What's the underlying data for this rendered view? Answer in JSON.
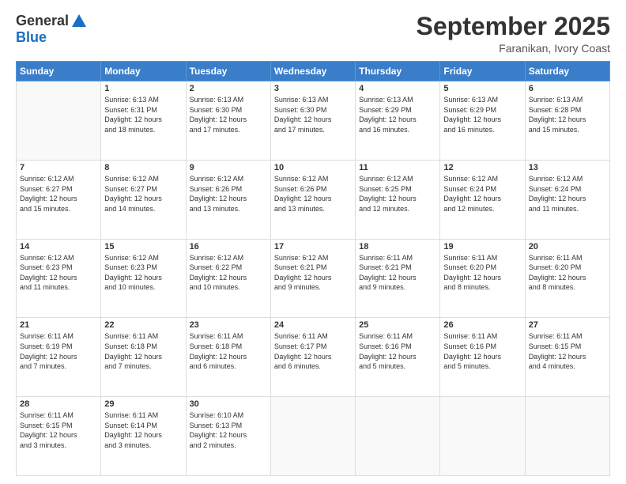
{
  "logo": {
    "general": "General",
    "blue": "Blue"
  },
  "header": {
    "month": "September 2025",
    "location": "Faranikan, Ivory Coast"
  },
  "weekdays": [
    "Sunday",
    "Monday",
    "Tuesday",
    "Wednesday",
    "Thursday",
    "Friday",
    "Saturday"
  ],
  "weeks": [
    [
      {
        "day": "",
        "info": ""
      },
      {
        "day": "1",
        "info": "Sunrise: 6:13 AM\nSunset: 6:31 PM\nDaylight: 12 hours\nand 18 minutes."
      },
      {
        "day": "2",
        "info": "Sunrise: 6:13 AM\nSunset: 6:30 PM\nDaylight: 12 hours\nand 17 minutes."
      },
      {
        "day": "3",
        "info": "Sunrise: 6:13 AM\nSunset: 6:30 PM\nDaylight: 12 hours\nand 17 minutes."
      },
      {
        "day": "4",
        "info": "Sunrise: 6:13 AM\nSunset: 6:29 PM\nDaylight: 12 hours\nand 16 minutes."
      },
      {
        "day": "5",
        "info": "Sunrise: 6:13 AM\nSunset: 6:29 PM\nDaylight: 12 hours\nand 16 minutes."
      },
      {
        "day": "6",
        "info": "Sunrise: 6:13 AM\nSunset: 6:28 PM\nDaylight: 12 hours\nand 15 minutes."
      }
    ],
    [
      {
        "day": "7",
        "info": "Sunrise: 6:12 AM\nSunset: 6:27 PM\nDaylight: 12 hours\nand 15 minutes."
      },
      {
        "day": "8",
        "info": "Sunrise: 6:12 AM\nSunset: 6:27 PM\nDaylight: 12 hours\nand 14 minutes."
      },
      {
        "day": "9",
        "info": "Sunrise: 6:12 AM\nSunset: 6:26 PM\nDaylight: 12 hours\nand 13 minutes."
      },
      {
        "day": "10",
        "info": "Sunrise: 6:12 AM\nSunset: 6:26 PM\nDaylight: 12 hours\nand 13 minutes."
      },
      {
        "day": "11",
        "info": "Sunrise: 6:12 AM\nSunset: 6:25 PM\nDaylight: 12 hours\nand 12 minutes."
      },
      {
        "day": "12",
        "info": "Sunrise: 6:12 AM\nSunset: 6:24 PM\nDaylight: 12 hours\nand 12 minutes."
      },
      {
        "day": "13",
        "info": "Sunrise: 6:12 AM\nSunset: 6:24 PM\nDaylight: 12 hours\nand 11 minutes."
      }
    ],
    [
      {
        "day": "14",
        "info": "Sunrise: 6:12 AM\nSunset: 6:23 PM\nDaylight: 12 hours\nand 11 minutes."
      },
      {
        "day": "15",
        "info": "Sunrise: 6:12 AM\nSunset: 6:23 PM\nDaylight: 12 hours\nand 10 minutes."
      },
      {
        "day": "16",
        "info": "Sunrise: 6:12 AM\nSunset: 6:22 PM\nDaylight: 12 hours\nand 10 minutes."
      },
      {
        "day": "17",
        "info": "Sunrise: 6:12 AM\nSunset: 6:21 PM\nDaylight: 12 hours\nand 9 minutes."
      },
      {
        "day": "18",
        "info": "Sunrise: 6:11 AM\nSunset: 6:21 PM\nDaylight: 12 hours\nand 9 minutes."
      },
      {
        "day": "19",
        "info": "Sunrise: 6:11 AM\nSunset: 6:20 PM\nDaylight: 12 hours\nand 8 minutes."
      },
      {
        "day": "20",
        "info": "Sunrise: 6:11 AM\nSunset: 6:20 PM\nDaylight: 12 hours\nand 8 minutes."
      }
    ],
    [
      {
        "day": "21",
        "info": "Sunrise: 6:11 AM\nSunset: 6:19 PM\nDaylight: 12 hours\nand 7 minutes."
      },
      {
        "day": "22",
        "info": "Sunrise: 6:11 AM\nSunset: 6:18 PM\nDaylight: 12 hours\nand 7 minutes."
      },
      {
        "day": "23",
        "info": "Sunrise: 6:11 AM\nSunset: 6:18 PM\nDaylight: 12 hours\nand 6 minutes."
      },
      {
        "day": "24",
        "info": "Sunrise: 6:11 AM\nSunset: 6:17 PM\nDaylight: 12 hours\nand 6 minutes."
      },
      {
        "day": "25",
        "info": "Sunrise: 6:11 AM\nSunset: 6:16 PM\nDaylight: 12 hours\nand 5 minutes."
      },
      {
        "day": "26",
        "info": "Sunrise: 6:11 AM\nSunset: 6:16 PM\nDaylight: 12 hours\nand 5 minutes."
      },
      {
        "day": "27",
        "info": "Sunrise: 6:11 AM\nSunset: 6:15 PM\nDaylight: 12 hours\nand 4 minutes."
      }
    ],
    [
      {
        "day": "28",
        "info": "Sunrise: 6:11 AM\nSunset: 6:15 PM\nDaylight: 12 hours\nand 3 minutes."
      },
      {
        "day": "29",
        "info": "Sunrise: 6:11 AM\nSunset: 6:14 PM\nDaylight: 12 hours\nand 3 minutes."
      },
      {
        "day": "30",
        "info": "Sunrise: 6:10 AM\nSunset: 6:13 PM\nDaylight: 12 hours\nand 2 minutes."
      },
      {
        "day": "",
        "info": ""
      },
      {
        "day": "",
        "info": ""
      },
      {
        "day": "",
        "info": ""
      },
      {
        "day": "",
        "info": ""
      }
    ]
  ]
}
